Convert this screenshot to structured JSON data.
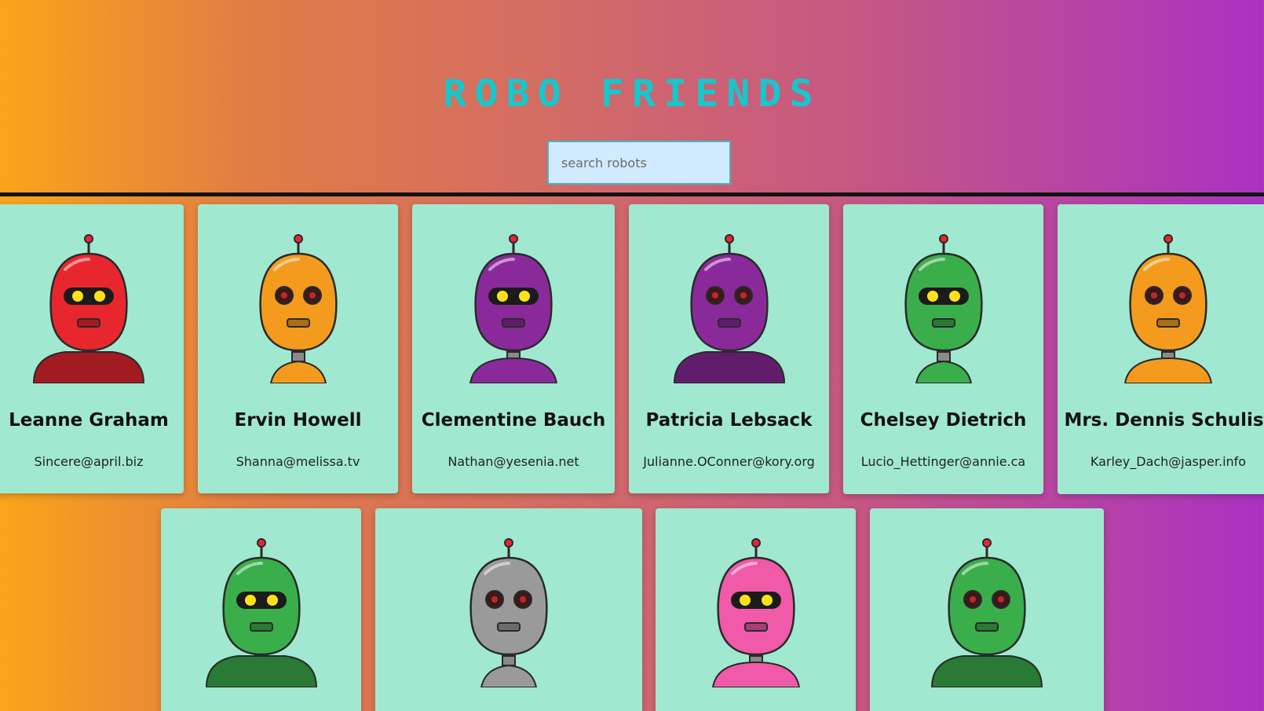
{
  "header": {
    "title": "Robo Friends"
  },
  "search": {
    "placeholder": "search robots"
  },
  "robots": [
    {
      "name": "Leanne Graham",
      "email": "Sincere@april.biz",
      "color": "#e8262e",
      "icon": "red-robot-icon"
    },
    {
      "name": "Ervin Howell",
      "email": "Shanna@melissa.tv",
      "color": "#f49b1e",
      "icon": "orange-robot-icon"
    },
    {
      "name": "Clementine Bauch",
      "email": "Nathan@yesenia.net",
      "color": "#8a2a9a",
      "icon": "purple-robot-icon"
    },
    {
      "name": "Patricia Lebsack",
      "email": "Julianne.OConner@kory.org",
      "color": "#8a2a9a",
      "icon": "purple-robot-icon"
    },
    {
      "name": "Chelsey Dietrich",
      "email": "Lucio_Hettinger@annie.ca",
      "color": "#3aae4a",
      "icon": "green-robot-icon"
    },
    {
      "name": "Mrs. Dennis Schulist",
      "email": "Karley_Dach@jasper.info",
      "color": "#f49b1e",
      "icon": "orange-robot-icon"
    },
    {
      "name": "",
      "email": "",
      "color": "#3aae4a",
      "icon": "green-robot-icon"
    },
    {
      "name": "",
      "email": "",
      "color": "#9a9a9a",
      "icon": "gray-robot-icon"
    },
    {
      "name": "",
      "email": "",
      "color": "#f05aa8",
      "icon": "pink-robot-icon"
    },
    {
      "name": "",
      "email": "",
      "color": "#3aae4a",
      "icon": "green-robot-icon"
    }
  ],
  "colors": {
    "card_background": "#a0e9d0",
    "title": "#16c7cc",
    "search_background": "#d2eafd"
  }
}
